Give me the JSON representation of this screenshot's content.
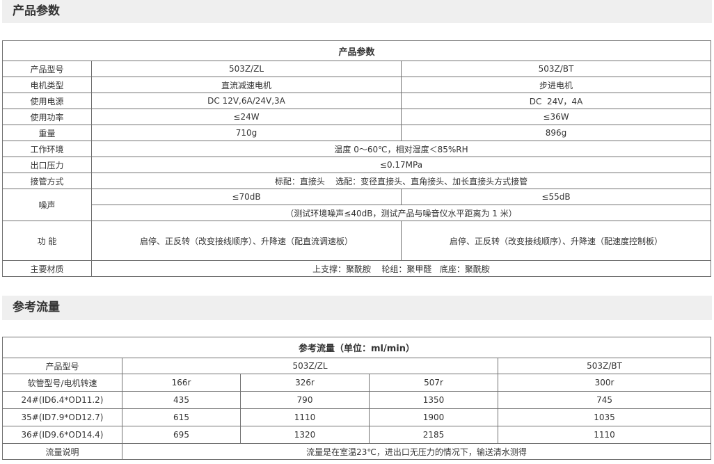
{
  "section1": {
    "header": "产品参数",
    "table_title": "产品参数",
    "model": {
      "label": "产品型号",
      "v1": "503Z/ZL",
      "v2": "503Z/BT"
    },
    "motor": {
      "label": "电机类型",
      "v1": "直流减速电机",
      "v2": "步进电机"
    },
    "power": {
      "label": "使用电源",
      "v1": "DC 12V,6A/24V,3A",
      "v2": "DC  24V，4A"
    },
    "wattage": {
      "label": "使用功率",
      "v1": "≤24W",
      "v2": "≤36W"
    },
    "weight": {
      "label": "重量",
      "v1": "710g",
      "v2": "896g"
    },
    "env": {
      "label": "工作环境",
      "value": "温度 0～60℃，相对湿度＜85%RH"
    },
    "pressure": {
      "label": "出口压力",
      "value": "≤0.17MPa"
    },
    "pipe": {
      "label": "接管方式",
      "value": "标配：直接头    选配：变径直接头、直角接头、加长直接头方式接管"
    },
    "noise": {
      "label": "噪声",
      "v1": "≤70dB",
      "v2": "≤55dB",
      "note": "（测试环境噪声≤40dB，测试产品与噪音仪水平距离为 1 米）"
    },
    "function": {
      "label": "功 能",
      "v1": "启停、正反转（改变接线顺序）、升降速（配直流调速板）",
      "v2": "启停、正反转（改变接线顺序）、升降速（配速度控制板）"
    },
    "material": {
      "label": "主要材质",
      "value": "上支撑：聚酰胺    轮组：聚甲醛   底座：聚酰胺"
    }
  },
  "section2": {
    "header": "参考流量",
    "table_title": "参考流量（单位：ml/min）",
    "model_label": "产品型号",
    "model_v1": "503Z/ZL",
    "model_v2": "503Z/BT",
    "speed_label": "软管型号/电机转速",
    "speeds": [
      "166r",
      "326r",
      "507r",
      "300r"
    ],
    "rows": [
      {
        "hose": "24#(ID6.4*OD11.2)",
        "values": [
          "435",
          "790",
          "1350",
          "745"
        ]
      },
      {
        "hose": "35#(ID7.9*OD12.7)",
        "values": [
          "615",
          "1110",
          "1900",
          "1035"
        ]
      },
      {
        "hose": "36#(ID9.6*OD14.4)",
        "values": [
          "695",
          "1320",
          "2185",
          "1110"
        ]
      }
    ],
    "note_label": "流量说明",
    "note_value": "流量是在室温23℃，进出口无压力的情况下，输送清水测得"
  }
}
